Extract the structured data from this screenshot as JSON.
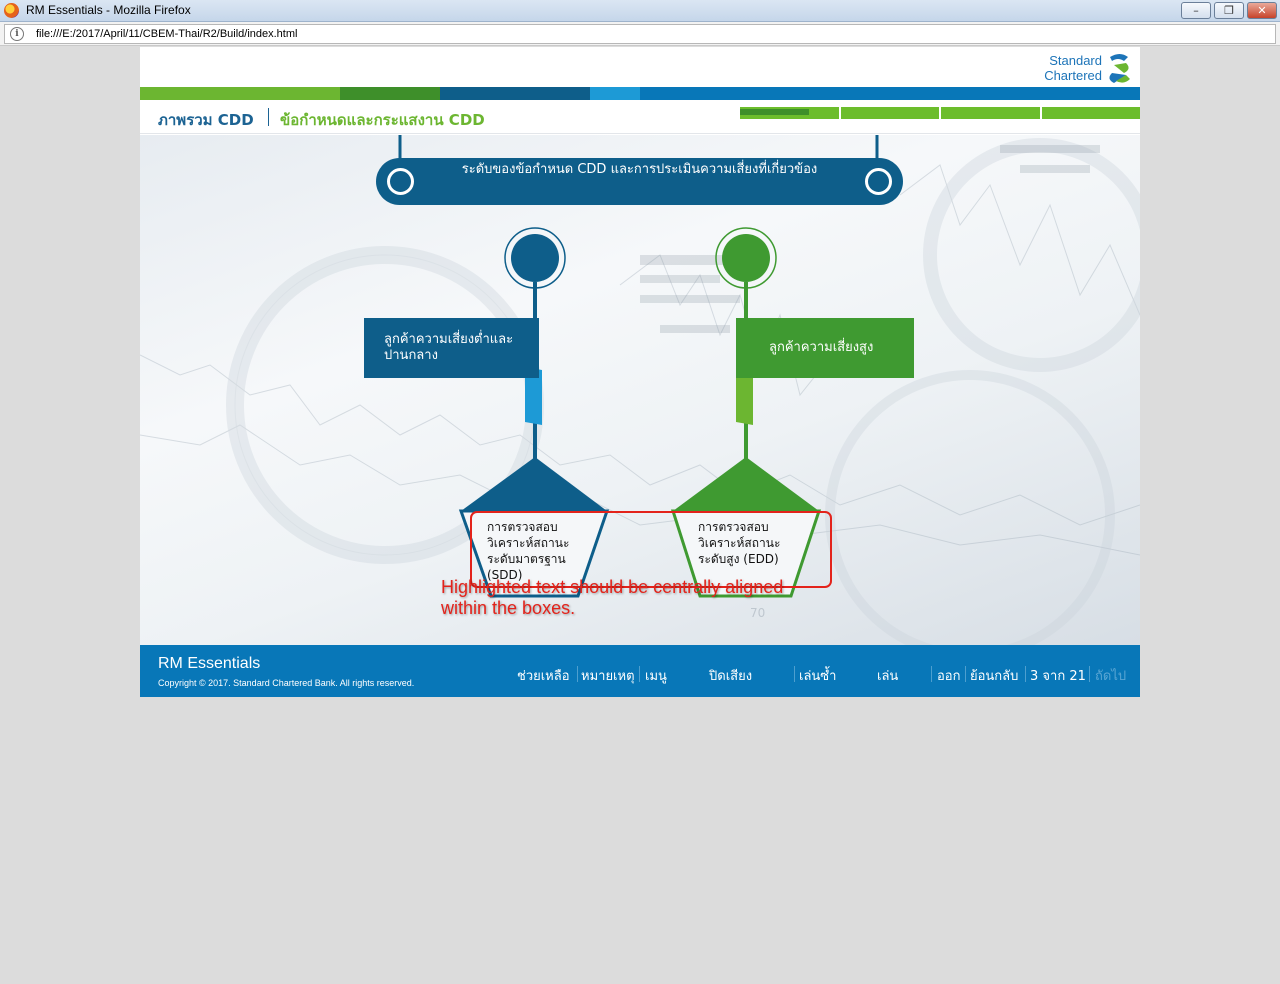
{
  "window": {
    "title": "RM Essentials - Mozilla Firefox",
    "minimize_glyph": "–",
    "maximize_glyph": "❐",
    "close_glyph": "✕"
  },
  "addressbar": {
    "info_glyph": "i",
    "url": "file:///E:/2017/April/11/CBEM-Thai/R2/Build/index.html"
  },
  "brand": {
    "line1": "Standard",
    "line2": "Chartered",
    "colors": [
      "#6cb631",
      "#3e8f2a",
      "#0e5e8a",
      "#1d9ad6",
      "#0877b8"
    ]
  },
  "breadcrumb": {
    "section": "ภาพรวม CDD",
    "topic": "ข้อกำหนดและกระแสงาน CDD"
  },
  "progress": {
    "segments": 4,
    "current_segment_fill": 0.7
  },
  "diagram": {
    "header": "ระดับของข้อกำหนด CDD และการประเมินความเสี่ยงที่เกี่ยวข้อง",
    "low_risk": "ลูกค้าความเสี่ยงต่ำและปานกลาง",
    "high_risk": "ลูกค้าความเสี่ยงสูง",
    "sdd": "การตรวจสอบ\nวิเคราะห์สถานะ\nระดับมาตรฐาน\n(SDD)",
    "edd": "การตรวจสอบ\nวิเคราะห์สถานะ\nระดับสูง (EDD)"
  },
  "annotation": {
    "text_line1": "Highlighted text should be centrally aligned",
    "text_line2": "within the boxes."
  },
  "footer": {
    "title": "RM Essentials",
    "copyright": "Copyright © 2017. Standard Chartered Bank. All rights reserved.",
    "help": "ช่วยเหลือ",
    "notes": "หมายเหตุ",
    "menu": "เมนู",
    "mute": "ปิดเสียง",
    "replay": "เล่นซ้ำ",
    "play": "เล่น",
    "exit": "ออก",
    "back": "ย้อนกลับ",
    "page": "3 จาก 21",
    "next": "ถัดไป"
  }
}
